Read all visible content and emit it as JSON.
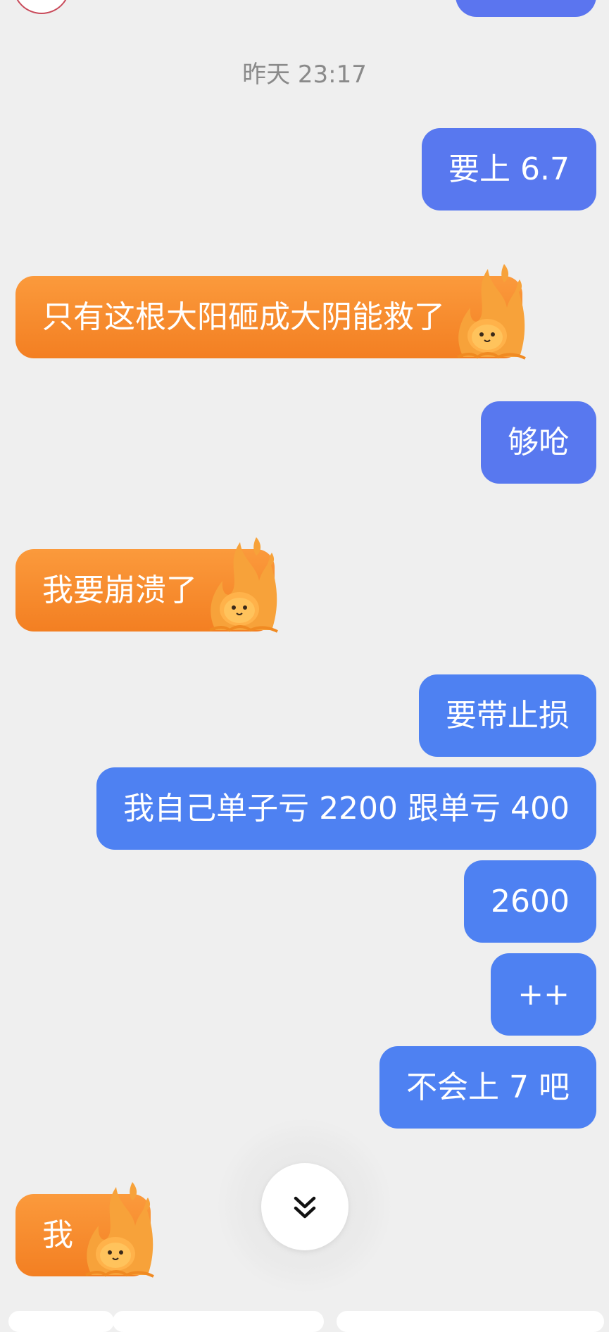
{
  "timestamp": "昨天 23:17",
  "messages": [
    {
      "id": 1,
      "side": "outgoing",
      "text": "要上 6.7"
    },
    {
      "id": 2,
      "side": "incoming",
      "text": "只有这根大阳砸成大阴能救了"
    },
    {
      "id": 3,
      "side": "outgoing",
      "text": "够呛"
    },
    {
      "id": 4,
      "side": "incoming",
      "text": "我要崩溃了"
    },
    {
      "id": 5,
      "side": "outgoing",
      "text": "要带止损"
    },
    {
      "id": 6,
      "side": "outgoing",
      "text": "我自己单子亏 2200 跟单亏 400"
    },
    {
      "id": 7,
      "side": "outgoing",
      "text": "2600"
    },
    {
      "id": 8,
      "side": "outgoing",
      "text": "++"
    },
    {
      "id": 9,
      "side": "outgoing",
      "text": "不会上 7 吧"
    },
    {
      "id": 10,
      "side": "incoming",
      "text": "我"
    }
  ],
  "icons": {
    "flame_sticker": "flame-sticker-icon",
    "scroll_down": "double-chevron-down-icon"
  },
  "colors": {
    "background": "#efefef",
    "outgoing_bubble": "#5878ef",
    "outgoing_bubble_alt": "#4e81f2",
    "incoming_bubble": "#f5872a",
    "timestamp_text": "#8a8a8a"
  }
}
